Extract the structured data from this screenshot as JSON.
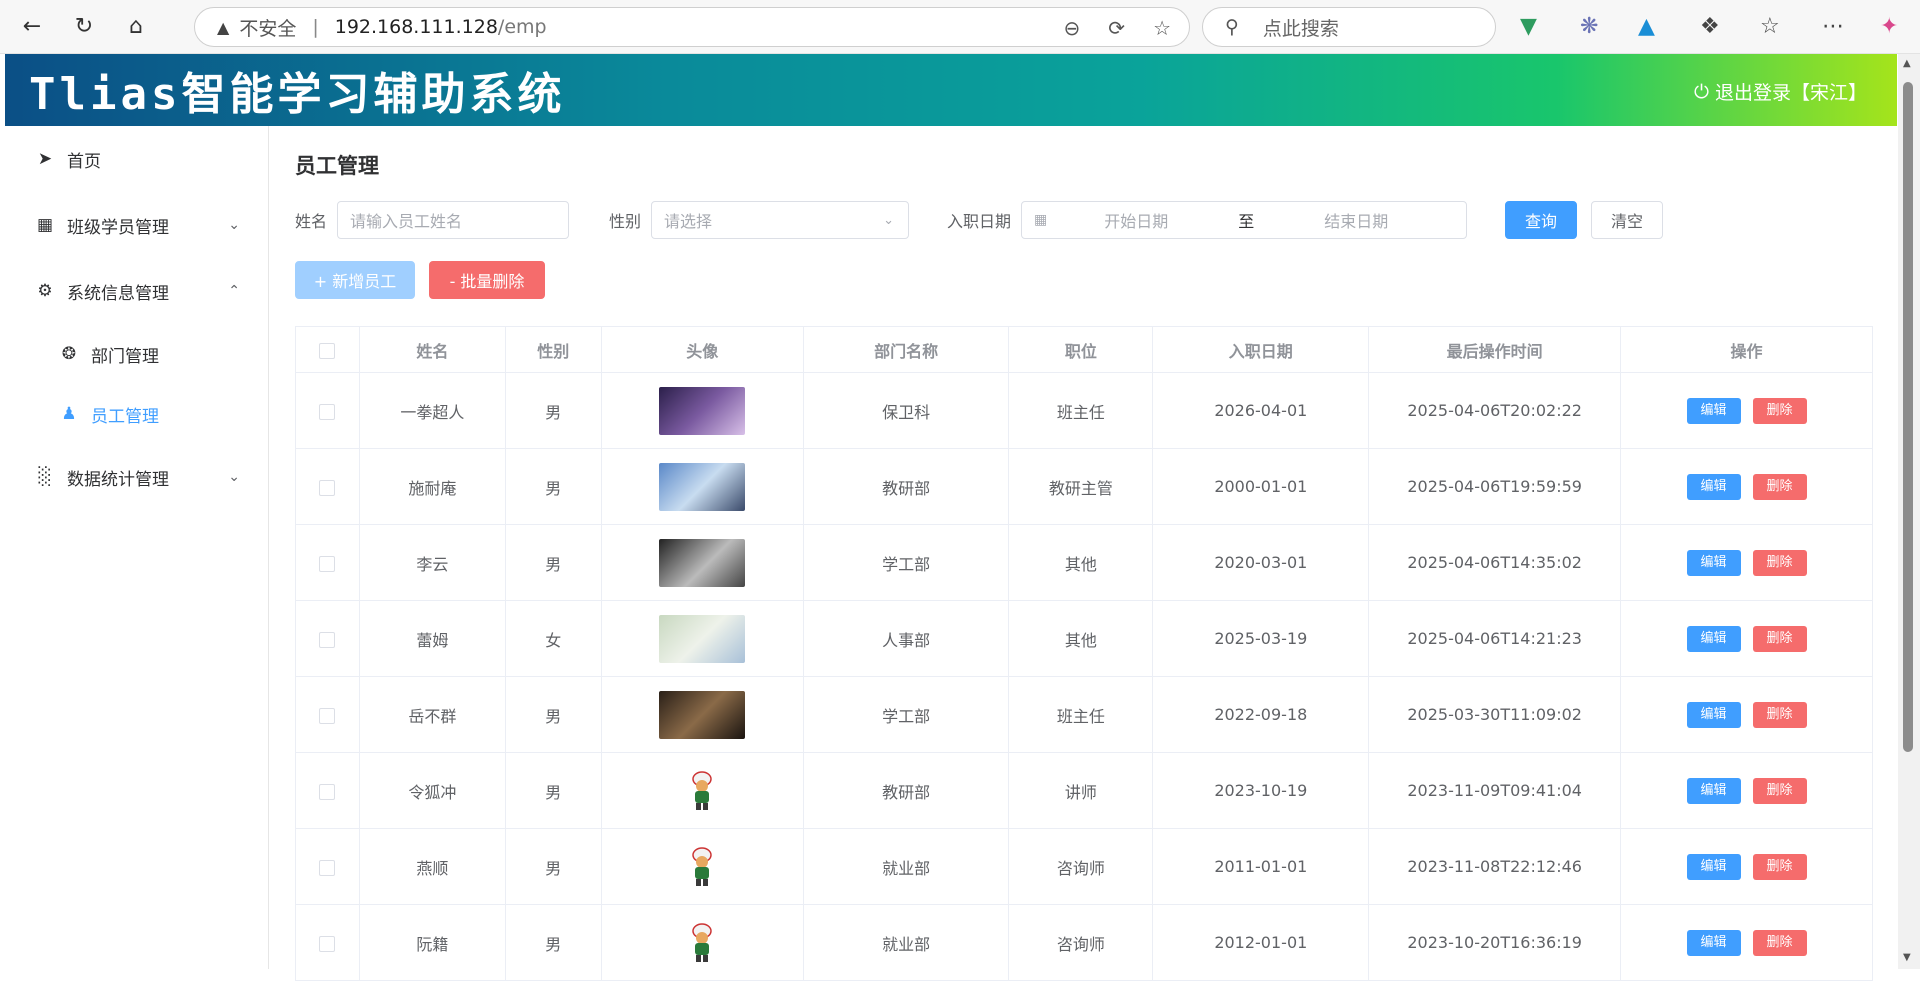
{
  "browser": {
    "insecure_label": "不安全",
    "url_host": "192.168.111.128",
    "url_path": "/emp",
    "search_placeholder": "点此搜索"
  },
  "header": {
    "title": "Tlias智能学习辅助系统",
    "logout_label": "退出登录【宋江】",
    "gradient_colors": [
      "#0b4f86",
      "#0aa39a",
      "#19c66c",
      "#a5e41b"
    ]
  },
  "sidebar": {
    "items": [
      {
        "label": "首页",
        "icon": "send-icon"
      },
      {
        "label": "班级学员管理",
        "icon": "grid-icon"
      },
      {
        "label": "系统信息管理",
        "icon": "gear-icon"
      },
      {
        "label": "数据统计管理",
        "icon": "bar-chart-icon"
      }
    ],
    "sub_items": [
      {
        "label": "部门管理",
        "icon": "aperture-icon"
      },
      {
        "label": "员工管理",
        "icon": "user-icon"
      }
    ],
    "active_color": "#409eff"
  },
  "page": {
    "title": "员工管理"
  },
  "search_form": {
    "name_label": "姓名",
    "name_placeholder": "请输入员工姓名",
    "gender_label": "性别",
    "gender_placeholder": "请选择",
    "date_label": "入职日期",
    "start_placeholder": "开始日期",
    "range_sep": "至",
    "end_placeholder": "结束日期",
    "query_button": "查询",
    "clear_button": "清空"
  },
  "actions": {
    "add_button": "+ 新增员工",
    "batch_delete_button": "- 批量删除"
  },
  "table": {
    "columns": [
      "姓名",
      "性别",
      "头像",
      "部门名称",
      "职位",
      "入职日期",
      "最后操作时间",
      "操作"
    ],
    "edit_label": "编辑",
    "delete_label": "删除",
    "rows": [
      {
        "name": "一拳超人",
        "gender": "男",
        "dept": "保卫科",
        "job": "班主任",
        "entry": "2026-04-01",
        "updated": "2025-04-06T20:02:22",
        "avatar": "photo"
      },
      {
        "name": "施耐庵",
        "gender": "男",
        "dept": "教研部",
        "job": "教研主管",
        "entry": "2000-01-01",
        "updated": "2025-04-06T19:59:59",
        "avatar": "photo"
      },
      {
        "name": "李云",
        "gender": "男",
        "dept": "学工部",
        "job": "其他",
        "entry": "2020-03-01",
        "updated": "2025-04-06T14:35:02",
        "avatar": "photo"
      },
      {
        "name": "蕾姆",
        "gender": "女",
        "dept": "人事部",
        "job": "其他",
        "entry": "2025-03-19",
        "updated": "2025-04-06T14:21:23",
        "avatar": "photo"
      },
      {
        "name": "岳不群",
        "gender": "男",
        "dept": "学工部",
        "job": "班主任",
        "entry": "2022-09-18",
        "updated": "2025-03-30T11:09:02",
        "avatar": "photo"
      },
      {
        "name": "令狐冲",
        "gender": "男",
        "dept": "教研部",
        "job": "讲师",
        "entry": "2023-10-19",
        "updated": "2023-11-09T09:41:04",
        "avatar": "mascot"
      },
      {
        "name": "燕顺",
        "gender": "男",
        "dept": "就业部",
        "job": "咨询师",
        "entry": "2011-01-01",
        "updated": "2023-11-08T22:12:46",
        "avatar": "mascot"
      },
      {
        "name": "阮籍",
        "gender": "男",
        "dept": "就业部",
        "job": "咨询师",
        "entry": "2012-01-01",
        "updated": "2023-10-20T16:36:19",
        "avatar": "mascot"
      }
    ]
  }
}
